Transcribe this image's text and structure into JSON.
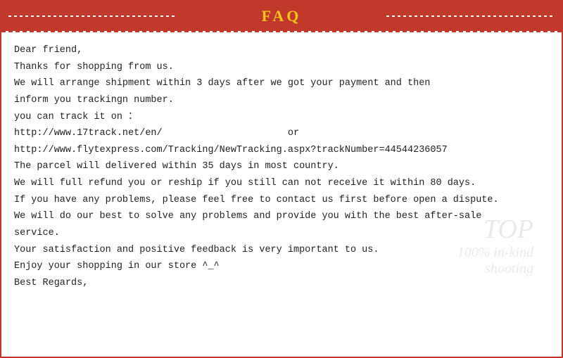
{
  "header": {
    "title": "FAQ"
  },
  "content": {
    "line1": "Dear friend,",
    "line2": "Thanks for shopping from us.",
    "line3": "We will arrange shipment within 3 days after we got your payment and then",
    "line4": "inform you trackingn number.",
    "line5": "you can track it on ：",
    "line6a": "http://www.17track.net/en/",
    "line6b": "or",
    "line7": "http://www.flytexpress.com/Tracking/NewTracking.aspx?trackNumber=44544236057",
    "line8": "The parcel will delivered within 35 days in most country.",
    "line9": "We will full refund you or reship if you still can not receive it within 80 days.",
    "line10": "If you have any problems, please feel free to contact us first before open a dispute.",
    "line11": "We will do our best to solve any problems and provide you with the best after-sale",
    "line12": "service.",
    "line13": "Your satisfaction and positive feedback is very important to us.",
    "line14": "Enjoy your shopping in our store ^_^",
    "line15": "Best Regards,"
  },
  "watermark": {
    "top": "TOP",
    "sub1": "100% in-kind",
    "sub2": "shooting"
  }
}
